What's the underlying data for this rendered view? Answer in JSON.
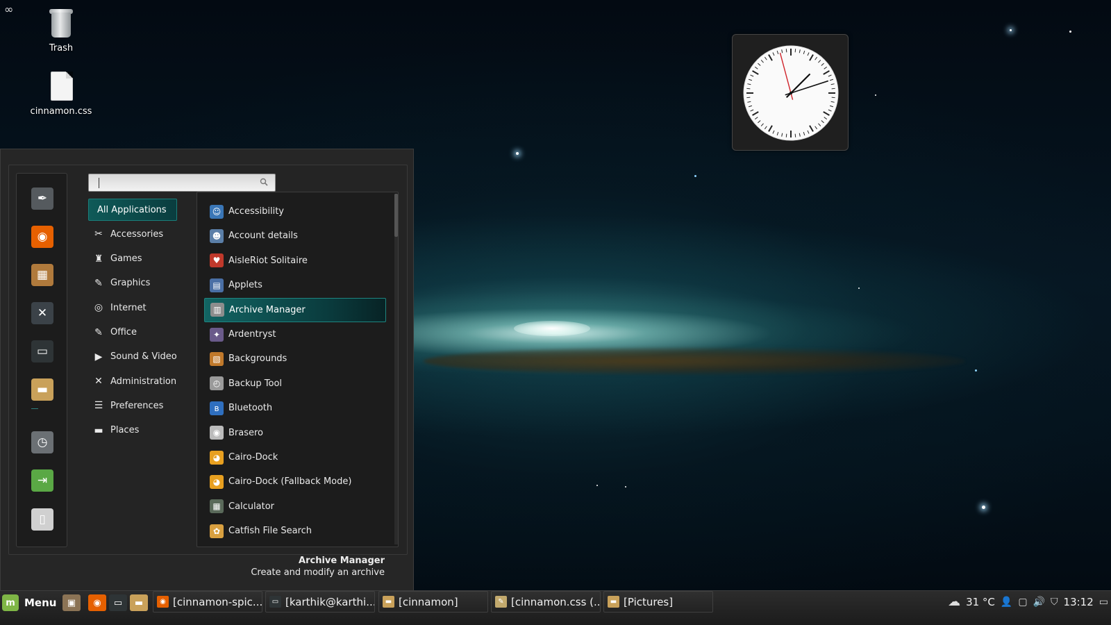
{
  "desktop": {
    "icons": [
      {
        "label": "Trash",
        "icon": "trash-icon"
      },
      {
        "label": "cinnamon.css",
        "icon": "file-icon"
      }
    ],
    "corner_glyph": "∞"
  },
  "clock": {
    "hour_hand_deg": 45,
    "minute_hand_deg": 72,
    "second_hand_deg": 345
  },
  "menu": {
    "search": {
      "placeholder": "",
      "value": ""
    },
    "favorites": [
      {
        "icon": "system-settings-icon",
        "color": "#555a5e"
      },
      {
        "icon": "firefox-icon",
        "color": "#e66000"
      },
      {
        "icon": "software-manager-icon",
        "color": "#b07a3c"
      },
      {
        "icon": "system-tools-icon",
        "color": "#3b4248"
      },
      {
        "icon": "terminal-icon",
        "color": "#2e3436"
      },
      {
        "icon": "files-icon",
        "color": "#c9a15a"
      },
      {
        "icon": "lock-screen-icon",
        "color": "#6b7074"
      },
      {
        "icon": "logout-icon",
        "color": "#5aa845"
      },
      {
        "icon": "shutdown-icon",
        "color": "#d0d0d0"
      }
    ],
    "categories": [
      {
        "label": "All Applications",
        "icon": "",
        "active": true
      },
      {
        "label": "Accessories",
        "icon": "accessories-icon"
      },
      {
        "label": "Games",
        "icon": "games-icon"
      },
      {
        "label": "Graphics",
        "icon": "graphics-icon"
      },
      {
        "label": "Internet",
        "icon": "internet-icon"
      },
      {
        "label": "Office",
        "icon": "office-icon"
      },
      {
        "label": "Sound & Video",
        "icon": "sound-video-icon"
      },
      {
        "label": "Administration",
        "icon": "administration-icon"
      },
      {
        "label": "Preferences",
        "icon": "preferences-icon"
      },
      {
        "label": "Places",
        "icon": "places-icon"
      }
    ],
    "apps": [
      {
        "label": "Accessibility",
        "icon": "accessibility-icon",
        "color": "#3a76b6"
      },
      {
        "label": "Account details",
        "icon": "account-icon",
        "color": "#5b7fa8"
      },
      {
        "label": "AisleRiot Solitaire",
        "icon": "solitaire-icon",
        "color": "#c0392b"
      },
      {
        "label": "Applets",
        "icon": "applets-icon",
        "color": "#4a6fa5"
      },
      {
        "label": "Archive Manager",
        "icon": "archive-icon",
        "color": "#8d8d8d",
        "selected": true
      },
      {
        "label": "Ardentryst",
        "icon": "ardentryst-icon",
        "color": "#6a5a8a"
      },
      {
        "label": "Backgrounds",
        "icon": "backgrounds-icon",
        "color": "#c0792b"
      },
      {
        "label": "Backup Tool",
        "icon": "backup-icon",
        "color": "#9a9a9a"
      },
      {
        "label": "Bluetooth",
        "icon": "bluetooth-icon",
        "color": "#2f6fbf"
      },
      {
        "label": "Brasero",
        "icon": "brasero-icon",
        "color": "#bbbbbb"
      },
      {
        "label": "Cairo-Dock",
        "icon": "cairo-dock-icon",
        "color": "#e8a020"
      },
      {
        "label": "Cairo-Dock (Fallback Mode)",
        "icon": "cairo-dock-fallback-icon",
        "color": "#e8a020"
      },
      {
        "label": "Calculator",
        "icon": "calculator-icon",
        "color": "#5a6a5a"
      },
      {
        "label": "Catfish File Search",
        "icon": "catfish-icon",
        "color": "#d9a040"
      }
    ],
    "description": {
      "title": "Archive Manager",
      "text": "Create and modify an archive"
    }
  },
  "taskbar": {
    "menu_label": "Menu",
    "launchers": [
      {
        "icon": "show-desktop-icon",
        "color": "#8b7355"
      },
      {
        "icon": "firefox-icon",
        "color": "#e66000"
      },
      {
        "icon": "terminal-icon",
        "color": "#2e3436"
      },
      {
        "icon": "files-icon",
        "color": "#c9a15a"
      }
    ],
    "windows": [
      {
        "label": "[cinnamon-spic...",
        "icon": "firefox-icon",
        "color": "#e66000"
      },
      {
        "label": "[karthik@karthi...",
        "icon": "terminal-icon",
        "color": "#2e3436"
      },
      {
        "label": "[cinnamon]",
        "icon": "folder-icon",
        "color": "#c9a15a"
      },
      {
        "label": "[cinnamon.css (...",
        "icon": "text-editor-icon",
        "color": "#c2a96d"
      },
      {
        "label": "[Pictures]",
        "icon": "folder-icon",
        "color": "#c9a15a"
      }
    ],
    "tray": {
      "weather": "31 °C",
      "time": "13:12"
    }
  }
}
